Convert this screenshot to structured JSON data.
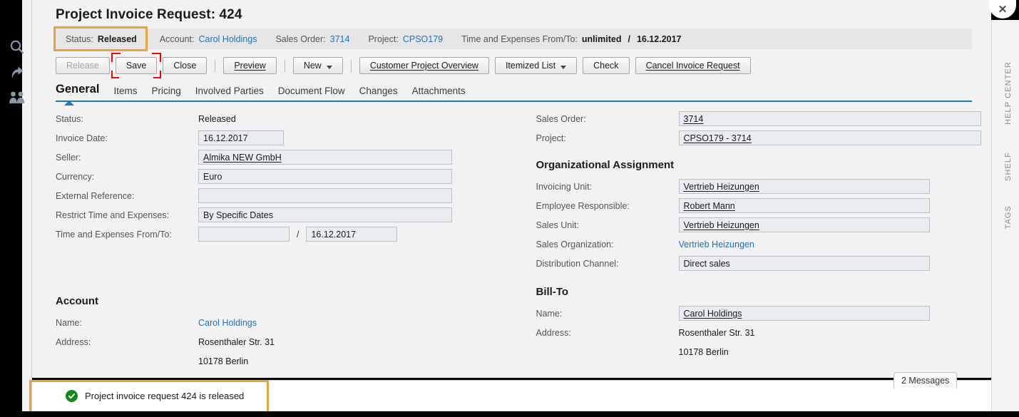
{
  "page": {
    "title": "Project Invoice Request: 424"
  },
  "status_strip": {
    "status_label": "Status:",
    "status_value": "Released",
    "account_label": "Account:",
    "account_value": "Carol Holdings",
    "sales_order_label": "Sales Order:",
    "sales_order_value": "3714",
    "project_label": "Project:",
    "project_value": "CPSO179",
    "time_expenses_label": "Time and Expenses From/To:",
    "time_expenses_from": "unlimited",
    "time_expenses_sep": "/",
    "time_expenses_to": "16.12.2017",
    "highlight_color": "#e9a33c"
  },
  "toolbar": {
    "buttons": [
      {
        "label": "Release",
        "disabled": true,
        "underline": false,
        "caret": false,
        "highlighted": false
      },
      {
        "label": "Save",
        "disabled": false,
        "underline": false,
        "caret": false,
        "highlighted": true
      },
      {
        "label": "Close",
        "disabled": false,
        "underline": false,
        "caret": false,
        "highlighted": false
      },
      {
        "label": "Preview",
        "disabled": false,
        "underline": true,
        "caret": false,
        "highlighted": false
      },
      {
        "label": "New",
        "disabled": false,
        "underline": false,
        "caret": true,
        "highlighted": false
      },
      {
        "label": "Customer Project Overview",
        "disabled": false,
        "underline": true,
        "caret": false,
        "highlighted": false
      },
      {
        "label": "Itemized List",
        "disabled": false,
        "underline": false,
        "caret": true,
        "highlighted": false
      },
      {
        "label": "Check",
        "disabled": false,
        "underline": false,
        "caret": false,
        "highlighted": false
      },
      {
        "label": "Cancel Invoice Request",
        "disabled": false,
        "underline": true,
        "caret": false,
        "highlighted": false
      }
    ],
    "highlight_color": "#ff0000"
  },
  "tabs": [
    {
      "label": "General",
      "active": true
    },
    {
      "label": "Items",
      "active": false
    },
    {
      "label": "Pricing",
      "active": false
    },
    {
      "label": "Involved Parties",
      "active": false
    },
    {
      "label": "Document Flow",
      "active": false
    },
    {
      "label": "Changes",
      "active": false
    },
    {
      "label": "Attachments",
      "active": false
    }
  ],
  "left_column": {
    "status": {
      "label": "Status:",
      "value": "Released"
    },
    "invoice_date": {
      "label": "Invoice Date:",
      "value": "16.12.2017"
    },
    "seller": {
      "label": "Seller:",
      "value": "Almika NEW GmbH"
    },
    "currency": {
      "label": "Currency:",
      "value": "Euro"
    },
    "external_reference": {
      "label": "External Reference:",
      "value": ""
    },
    "restrict_time_expenses": {
      "label": "Restrict Time and Expenses:",
      "value": "By Specific Dates"
    },
    "time_expenses_fromto": {
      "label": "Time and Expenses From/To:",
      "from": "",
      "separator": "/",
      "to": "16.12.2017"
    }
  },
  "right_column": {
    "sales_order": {
      "label": "Sales Order:",
      "value": "3714"
    },
    "project": {
      "label": "Project:",
      "value": "CPSO179 - 3714"
    },
    "org_heading": "Organizational Assignment",
    "invoicing_unit": {
      "label": "Invoicing Unit:",
      "value": "Vertrieb Heizungen"
    },
    "employee_responsible": {
      "label": "Employee Responsible:",
      "value": "Robert Mann"
    },
    "sales_unit": {
      "label": "Sales Unit:",
      "value": "Vertrieb Heizungen"
    },
    "sales_organization": {
      "label": "Sales Organization:",
      "value": "Vertrieb Heizungen"
    },
    "distribution_channel": {
      "label": "Distribution Channel:",
      "value": "Direct sales"
    }
  },
  "account_section": {
    "heading": "Account",
    "name_label": "Name:",
    "name_value": "Carol Holdings",
    "address_label": "Address:",
    "address_line1": "Rosenthaler Str. 31",
    "address_line2": "10178 Berlin"
  },
  "billto_section": {
    "heading": "Bill-To",
    "name_label": "Name:",
    "name_value": "Carol Holdings",
    "address_label": "Address:",
    "address_line1": "Rosenthaler Str. 31",
    "address_line2": "10178 Berlin"
  },
  "messages": {
    "pill_label": "2 Messages",
    "bar_text": "Project invoice request 424 is released",
    "icon": "success-check-icon",
    "icon_color": "#108a18",
    "highlight_color": "#e9a33c"
  },
  "left_rail": {
    "icons": [
      "search-icon",
      "share-arrow-icon",
      "people-icon"
    ]
  },
  "right_rail": {
    "close_label": "✕",
    "labels": [
      "HELP CENTER",
      "SHELF",
      "TAGS"
    ]
  }
}
